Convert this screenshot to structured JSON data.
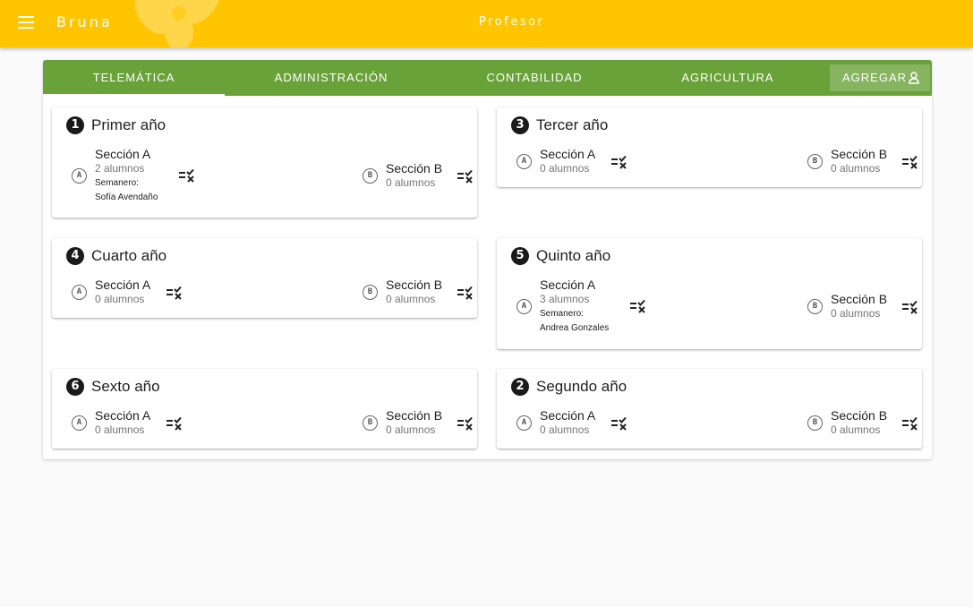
{
  "app": {
    "brand": "Bruna",
    "role": "Profesor"
  },
  "tabs": [
    {
      "label": "TELEMÁTICA",
      "active": true
    },
    {
      "label": "ADMINISTRACIÓN",
      "active": false
    },
    {
      "label": "CONTABILIDAD",
      "active": false
    },
    {
      "label": "AGRICULTURA",
      "active": false
    }
  ],
  "add_button": {
    "label": "AGREGAR",
    "icon": "add-user-icon"
  },
  "colors": {
    "appbar": "#ffc500",
    "tabs": "#6aa23a"
  },
  "cards": [
    {
      "number": "1",
      "title": "Primer año",
      "sections": [
        {
          "letter": "A",
          "name": "Sección A",
          "count": "2 alumnos",
          "mentor_label": "Semanero:",
          "mentor": "Sofía Avendaño"
        },
        {
          "letter": "B",
          "name": "Sección B",
          "count": "0 alumnos"
        }
      ]
    },
    {
      "number": "3",
      "title": "Tercer año",
      "sections": [
        {
          "letter": "A",
          "name": "Sección A",
          "count": "0 alumnos"
        },
        {
          "letter": "B",
          "name": "Sección B",
          "count": "0 alumnos"
        }
      ]
    },
    {
      "number": "4",
      "title": "Cuarto año",
      "sections": [
        {
          "letter": "A",
          "name": "Sección A",
          "count": "0 alumnos"
        },
        {
          "letter": "B",
          "name": "Sección B",
          "count": "0 alumnos"
        }
      ]
    },
    {
      "number": "5",
      "title": "Quinto año",
      "sections": [
        {
          "letter": "A",
          "name": "Sección A",
          "count": "3 alumnos",
          "mentor_label": "Semanero:",
          "mentor": "Andrea Gonzales"
        },
        {
          "letter": "B",
          "name": "Sección B",
          "count": "0 alumnos"
        }
      ]
    },
    {
      "number": "6",
      "title": "Sexto año",
      "sections": [
        {
          "letter": "A",
          "name": "Sección A",
          "count": "0 alumnos"
        },
        {
          "letter": "B",
          "name": "Sección B",
          "count": "0 alumnos"
        }
      ]
    },
    {
      "number": "2",
      "title": "Segundo año",
      "sections": [
        {
          "letter": "A",
          "name": "Sección A",
          "count": "0 alumnos"
        },
        {
          "letter": "B",
          "name": "Sección B",
          "count": "0 alumnos"
        }
      ]
    }
  ]
}
